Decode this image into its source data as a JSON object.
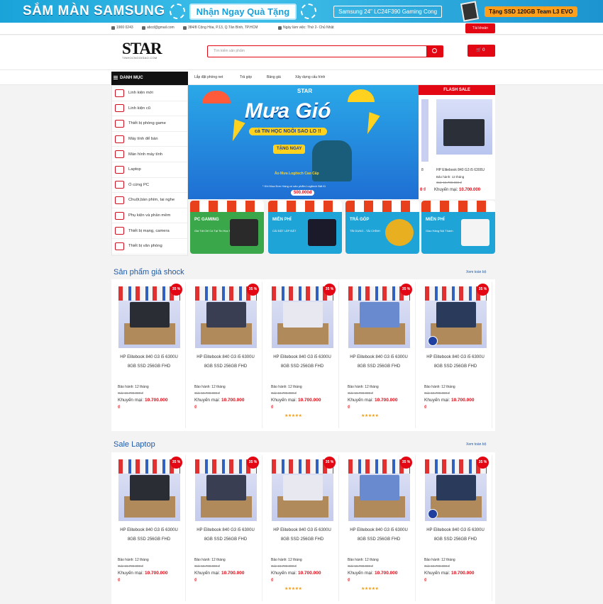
{
  "banner": {
    "title": "SẮM MÀN SAMSUNG",
    "gift": "Nhận Ngay Quà Tặng",
    "model": "Samsung 24\" LC24F390 Gaming Cong",
    "gift_item": "Tặng SSD 120GB Team L3 EVO"
  },
  "topbar": {
    "phone": "1900 0243",
    "email": "abcd@gmail.com",
    "address": "384/8 Cộng Hòa, P.13, Q.Tân Bình, TP.HCM",
    "hours": "Ngày làm việc: Thứ 2- Chủ Nhật",
    "account": "Tài khoản"
  },
  "header": {
    "logo_main": "STAR",
    "logo_sub": "TINHOCNGOISAO.COM",
    "search_placeholder": "Tìm kiếm sản phẩm",
    "cart_count": "0"
  },
  "nav": {
    "category_title": "DANH MỤC",
    "items": [
      "Lắp đặt phòng net",
      "Trả góp",
      "Bảng giá",
      "Xây dựng cấu hình"
    ]
  },
  "sidebar": [
    {
      "label": "Linh kiện mới"
    },
    {
      "label": "Linh kiện cũ"
    },
    {
      "label": "Thiết bị phòng game"
    },
    {
      "label": "Máy tính để bàn"
    },
    {
      "label": "Màn hình máy tính"
    },
    {
      "label": "Laptop"
    },
    {
      "label": "Ổ cứng PC"
    },
    {
      "label": "Chuột,bàn phím, tai nghe"
    },
    {
      "label": "Phụ kiện và phần mềm"
    },
    {
      "label": "Thiết bị mạng, camera"
    },
    {
      "label": "Thiết bị văn phòng"
    }
  ],
  "slider": {
    "logo": "STAR",
    "title": "Mưa Gió",
    "subtitle": "cả TIN HỌC NGÔI SAO LO !!",
    "gift": "TẶNG NGAY",
    "product": "Áo Mưa Logitech Cao Cấp",
    "note": "* Khi Mua Đơn Hàng có sản phẩm Logitech Bất Kì",
    "threshold": "500.000đ"
  },
  "flash": {
    "title": "FLASH SALE",
    "name": "HP Elitebook 840 G3 i5 6300U",
    "warranty": "Bảo hành: 12 tháng",
    "old_price": "Giá: 15.700.000 đ",
    "promo_label": "Khuyến mại:",
    "promo_price": "10.700.000",
    "prev_name": "8",
    "prev_price": "0 ₫"
  },
  "promos": [
    {
      "label": "PC GAMING",
      "sub": "Giá Tốt Chỉ Có Tại Tin Học Ngôi Sao",
      "color": "#3aa84a"
    },
    {
      "label": "MIỄN PHÍ",
      "sub": "CÀI ĐẶT LẮP ĐẶT",
      "color": "#1fa4d8"
    },
    {
      "label": "TRẢ GÓP",
      "sub": "TÍN DỤNG - TÀI CHÍNH",
      "color": "#1fa4d8"
    },
    {
      "label": "MIỄN PHÍ",
      "sub": "Giao Hàng Nội Thành",
      "color": "#1fa4d8"
    }
  ],
  "sections": [
    {
      "title": "Sản phẩm giá shock",
      "see_all": "Xem toàn bộ"
    },
    {
      "title": "Sale Laptop",
      "see_all": "Xem toàn bộ"
    }
  ],
  "product": {
    "badge": "35 %",
    "name": "HP Elitebook 840 G3 i5 6300U 8GB SSD 256GB FHD",
    "warranty": "Bảo hành: 12 tháng",
    "old_price": "Giá: 15.700.000 đ",
    "promo_label": "Khuyến mại:",
    "promo_price": "10.700.000",
    "currency": "₫",
    "stars": "★★★★★"
  },
  "colors": {
    "accent": "#e30613",
    "link": "#1e5aa8",
    "banner": "#1aa0da"
  }
}
